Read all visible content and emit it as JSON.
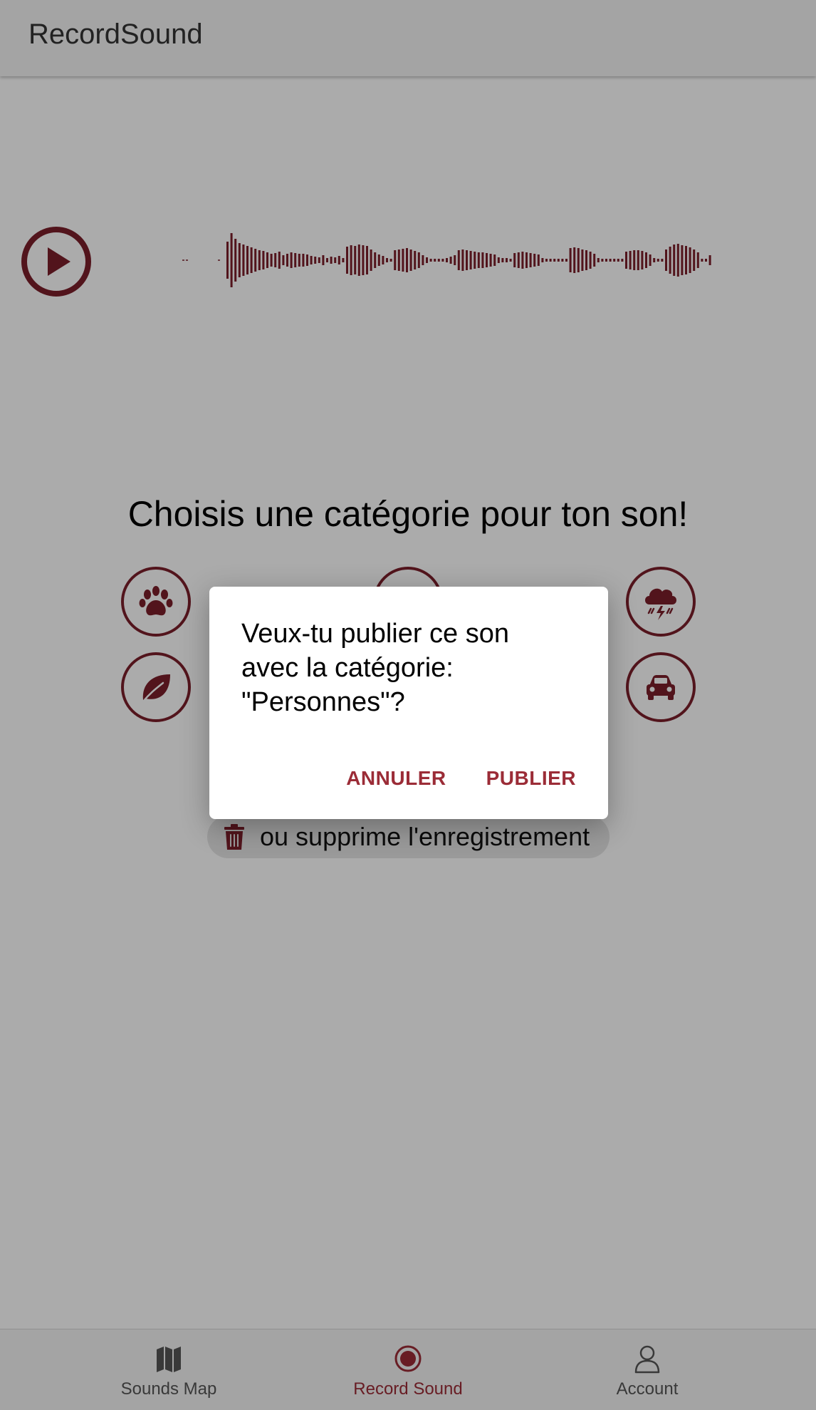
{
  "app": {
    "title": "RecordSound"
  },
  "player": {
    "play_icon": "play-circle-icon"
  },
  "categories": {
    "title": "Choisis une catégorie pour ton son!",
    "items": [
      {
        "name": "animals",
        "icon": "paw-icon"
      },
      {
        "name": "people",
        "icon": "person-icon"
      },
      {
        "name": "weather",
        "icon": "storm-cloud-icon"
      },
      {
        "name": "nature",
        "icon": "leaf-icon"
      },
      {
        "name": "vehicles",
        "icon": "car-icon"
      }
    ],
    "delete_label": "ou supprime l'enregistrement"
  },
  "dialog": {
    "line1": "Veux-tu publier ce son",
    "line2": "avec la catégorie:",
    "line3": "\"Personnes\"?",
    "cancel_label": "ANNULER",
    "publish_label": "PUBLIER"
  },
  "bottom_nav": {
    "items": [
      {
        "label": "Sounds Map",
        "icon": "map-icon",
        "active": false
      },
      {
        "label": "Record Sound",
        "icon": "record-icon",
        "active": true
      },
      {
        "label": "Account",
        "icon": "account-icon",
        "active": false
      }
    ]
  },
  "colors": {
    "accent": "#9b2c37",
    "icon": "#7b1f2a",
    "overlay": "rgba(0,0,0,0.33)"
  }
}
